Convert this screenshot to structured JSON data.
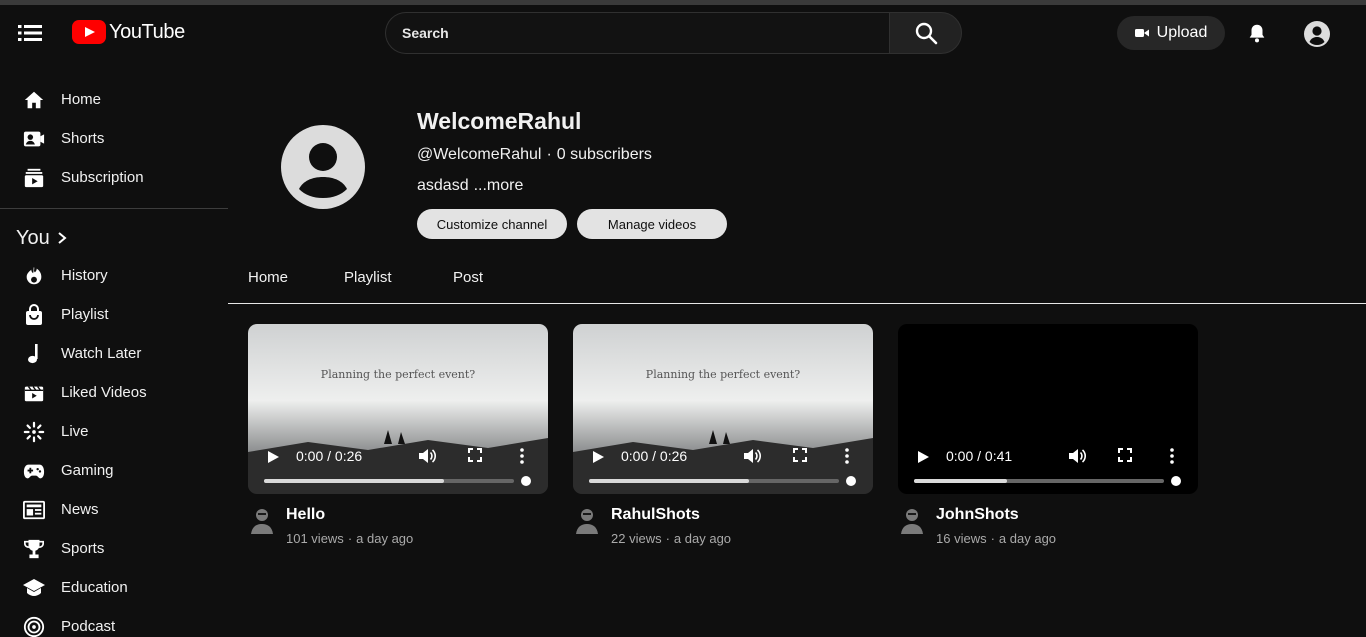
{
  "header": {
    "logo_text": "YouTube",
    "search_placeholder": "Search",
    "upload_label": "Upload"
  },
  "sidebar": {
    "main": [
      {
        "label": "Home",
        "icon": "home-icon"
      },
      {
        "label": "Shorts",
        "icon": "shorts-icon"
      },
      {
        "label": "Subscription",
        "icon": "subscriptions-icon"
      }
    ],
    "you_label": "You",
    "you_items": [
      {
        "label": "History",
        "icon": "history-icon"
      },
      {
        "label": "Playlist",
        "icon": "playlist-icon"
      },
      {
        "label": "Watch Later",
        "icon": "music-note-icon"
      },
      {
        "label": "Liked Videos",
        "icon": "liked-videos-icon"
      },
      {
        "label": "Live",
        "icon": "live-icon"
      },
      {
        "label": "Gaming",
        "icon": "gamepad-icon"
      },
      {
        "label": "News",
        "icon": "news-icon"
      },
      {
        "label": "Sports",
        "icon": "trophy-icon"
      },
      {
        "label": "Education",
        "icon": "graduation-cap-icon"
      },
      {
        "label": "Podcast",
        "icon": "podcast-icon"
      }
    ]
  },
  "channel": {
    "name": "WelcomeRahul",
    "handle": "@WelcomeRahul",
    "separator": "·",
    "subscribers": "0 subscribers",
    "description": "asdasd",
    "more_label": "...more",
    "customize_label": "Customize channel",
    "manage_label": "Manage videos"
  },
  "tabs": [
    "Home",
    "Playlist",
    "Post"
  ],
  "videos": [
    {
      "title": "Hello",
      "views": "101 views",
      "dot": "·",
      "age": "a day ago",
      "time": "0:00 / 0:26",
      "caption": "Planning the perfect event?",
      "progress": 0.72
    },
    {
      "title": "RahulShots",
      "views": "22 views",
      "dot": "·",
      "age": "a day ago",
      "time": "0:00 / 0:26",
      "caption": "Planning the perfect event?",
      "progress": 0.64
    },
    {
      "title": "JohnShots",
      "views": "16 views",
      "dot": "·",
      "age": "a day ago",
      "time": "0:00 / 0:41",
      "caption": "",
      "progress": 0.37
    }
  ],
  "colors": {
    "background": "#0f0f0f",
    "brand_red": "#ff0000",
    "pill_bg": "#e3e3e3",
    "muted_text": "#aaaaaa"
  }
}
